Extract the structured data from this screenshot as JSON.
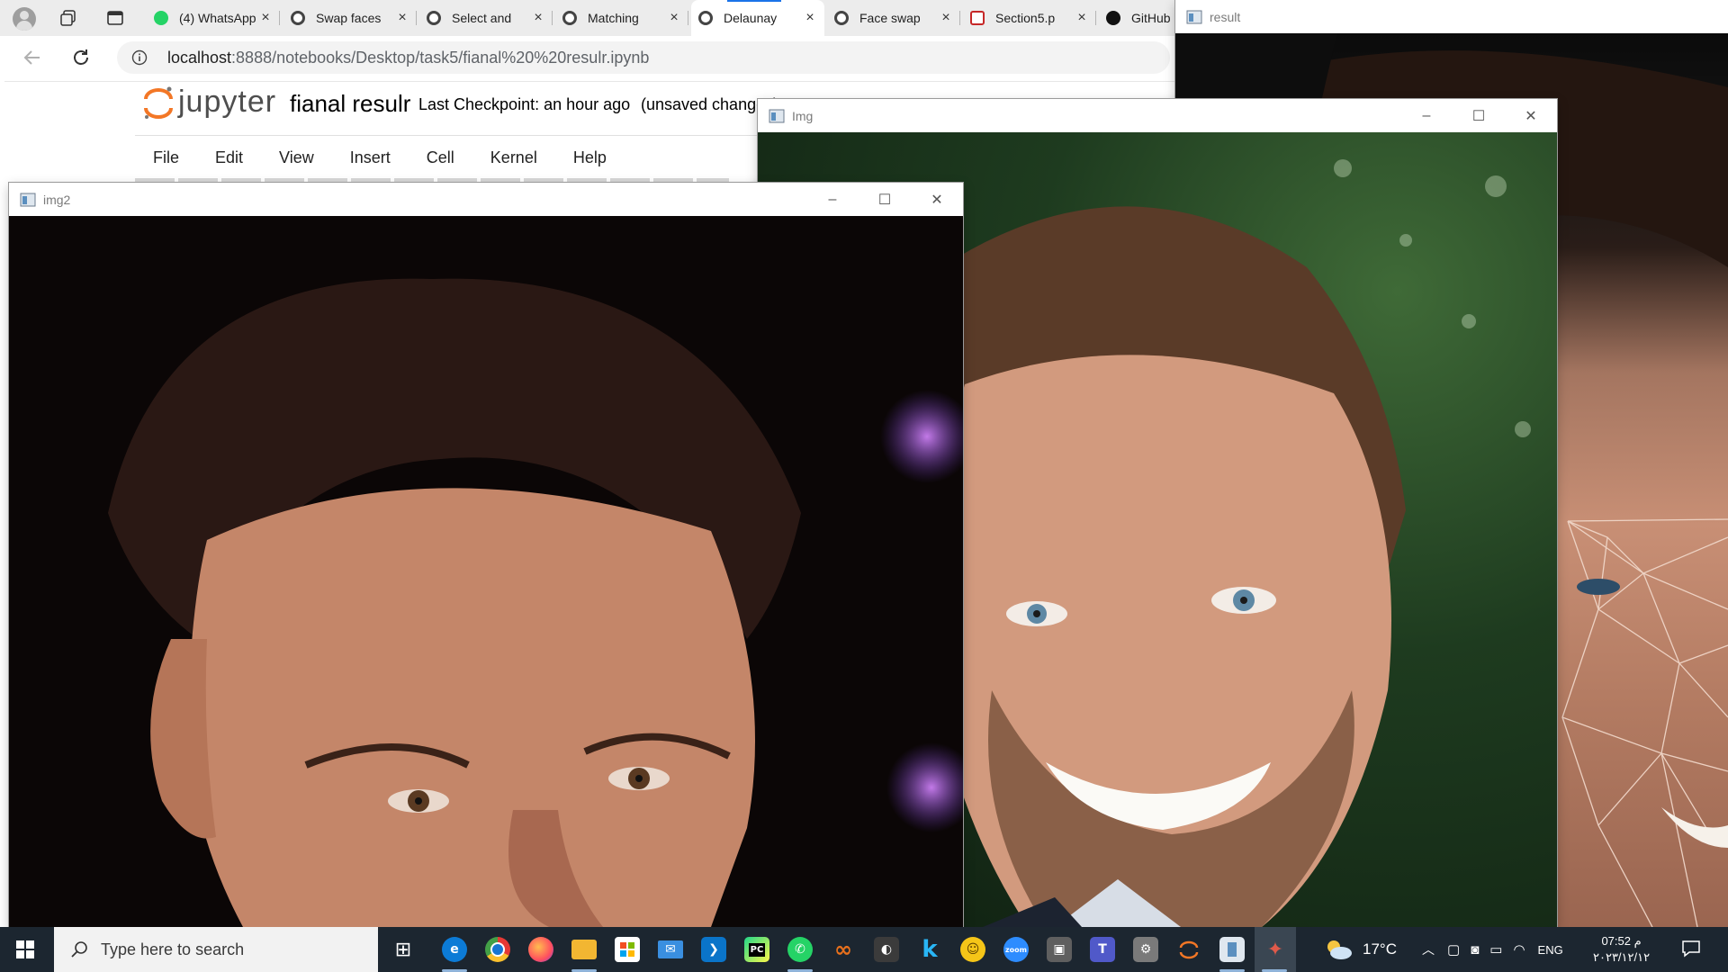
{
  "browser": {
    "tabs": [
      {
        "label": "(4) WhatsApp",
        "favicon": "whatsapp-icon",
        "color": "#25d366"
      },
      {
        "label": "Swap faces",
        "favicon": "jupyter-icon",
        "color": "#f37726"
      },
      {
        "label": "Select and",
        "favicon": "jupyter-icon",
        "color": "#f37726"
      },
      {
        "label": "Matching",
        "favicon": "jupyter-icon",
        "color": "#f37726"
      },
      {
        "label": "Delaunay",
        "favicon": "jupyter-icon",
        "color": "#f37726"
      },
      {
        "label": "Face swap",
        "favicon": "jupyter-icon",
        "color": "#f37726"
      },
      {
        "label": "Section5.p",
        "favicon": "pdf-icon",
        "color": "#c62828"
      },
      {
        "label": "GitHub",
        "favicon": "github-icon",
        "color": "#111111"
      }
    ],
    "url_host": "localhost",
    "url_path": ":8888/notebooks/Desktop/task5/fianal%20%20resulr.ipynb"
  },
  "jupyter": {
    "logo_text": "jupyter",
    "notebook_title": "fianal resulr",
    "checkpoint": "Last Checkpoint: an hour ago",
    "unsaved": "(unsaved changes)",
    "menu": [
      "File",
      "Edit",
      "View",
      "Insert",
      "Cell",
      "Kernel",
      "Help"
    ]
  },
  "windows": {
    "result": {
      "title": "result"
    },
    "img": {
      "title": "Img"
    },
    "img2": {
      "title": "img2"
    }
  },
  "taskbar": {
    "search_placeholder": "Type here to search",
    "apps": [
      {
        "name": "task-view-icon",
        "color": "#1c2630",
        "glyph": "⊞"
      },
      {
        "name": "edge-icon",
        "color": "#0c7bd6",
        "glyph": "e"
      },
      {
        "name": "chrome-icon",
        "color": "#e53935",
        "glyph": "◉"
      },
      {
        "name": "firefox-icon",
        "color": "#ff7139",
        "glyph": "ƒ"
      },
      {
        "name": "file-explorer-icon",
        "color": "#f2b632",
        "glyph": "▤"
      },
      {
        "name": "store-icon",
        "color": "#4f8ef7",
        "glyph": "▦"
      },
      {
        "name": "mail-icon",
        "color": "#3a8fe0",
        "glyph": "✉"
      },
      {
        "name": "vscode-icon",
        "color": "#0a74c9",
        "glyph": "❯"
      },
      {
        "name": "pycharm-icon",
        "color": "#111111",
        "glyph": "PC"
      },
      {
        "name": "whatsapp-icon",
        "color": "#25d366",
        "glyph": "✆"
      },
      {
        "name": "infinity-icon",
        "color": "#e8701c",
        "glyph": "∞"
      },
      {
        "name": "github-icon",
        "color": "#3b3b3b",
        "glyph": "◐"
      },
      {
        "name": "k-icon",
        "color": "#1c2630",
        "glyph": "k"
      },
      {
        "name": "emoji-icon",
        "color": "#f5c518",
        "glyph": "☺"
      },
      {
        "name": "zoom-icon",
        "color": "#2d8cff",
        "glyph": "zm"
      },
      {
        "name": "calculator-icon",
        "color": "#555555",
        "glyph": "▣"
      },
      {
        "name": "teams-icon",
        "color": "#5059c9",
        "glyph": "T"
      },
      {
        "name": "pc-health-icon",
        "color": "#7a7a7a",
        "glyph": "⚙"
      },
      {
        "name": "jupyter-icon",
        "color": "#1c2630",
        "glyph": "◌"
      },
      {
        "name": "opencv-window-icon",
        "color": "#6b7b8c",
        "glyph": "▭"
      },
      {
        "name": "python-icon",
        "color": "#c0392b",
        "glyph": "✦"
      }
    ],
    "weather": "17°C",
    "language": "ENG",
    "time": "07:52 م",
    "date": "۲۰۲۳/۱۲/۱۲"
  }
}
